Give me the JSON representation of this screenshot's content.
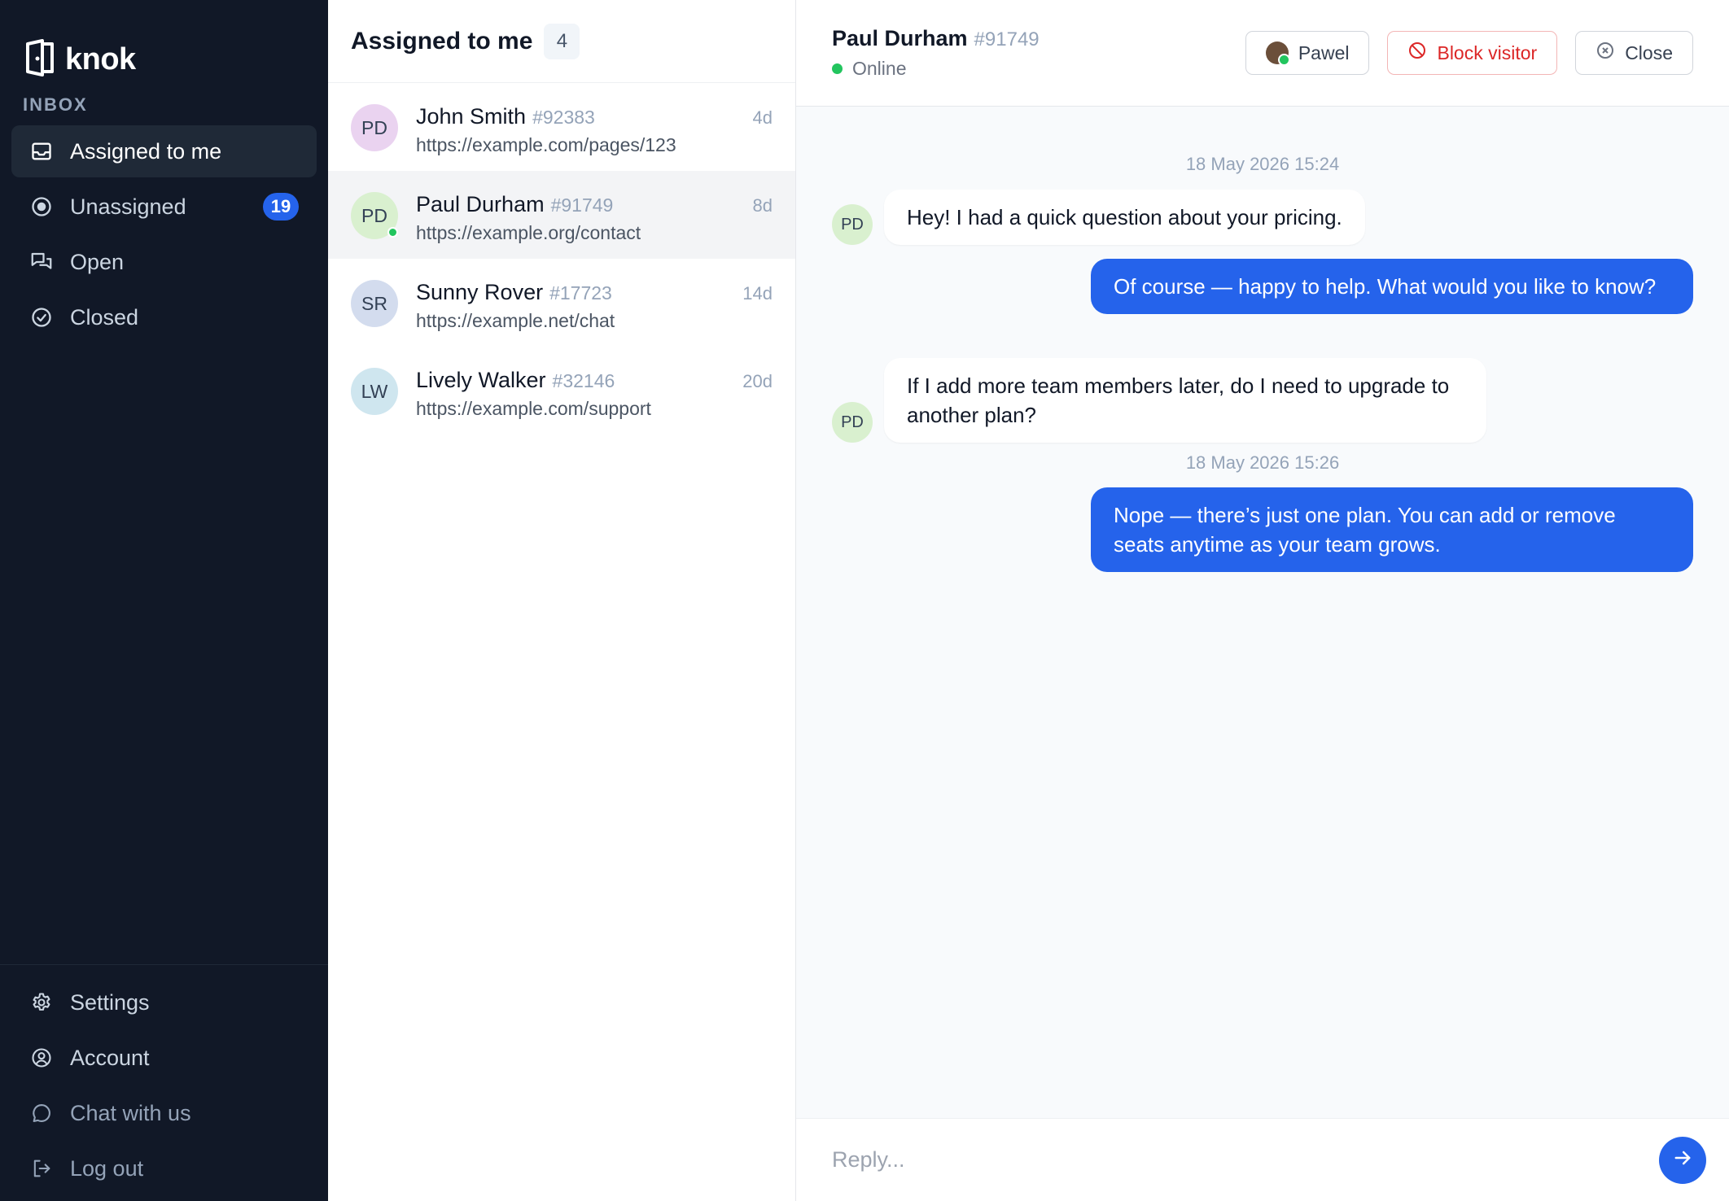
{
  "app": {
    "name": "knok"
  },
  "sidebar": {
    "section_label": "INBOX",
    "items": [
      {
        "label": "Assigned to me",
        "icon": "inbox-icon",
        "active": true
      },
      {
        "label": "Unassigned",
        "icon": "target-icon",
        "badge": "19"
      },
      {
        "label": "Open",
        "icon": "chat-bubbles-icon"
      },
      {
        "label": "Closed",
        "icon": "check-circle-icon"
      }
    ],
    "bottom_items": [
      {
        "label": "Settings",
        "icon": "gear-icon"
      },
      {
        "label": "Account",
        "icon": "user-circle-icon"
      },
      {
        "label": "Chat with us",
        "icon": "chat-bubble-icon"
      },
      {
        "label": "Log out",
        "icon": "logout-icon"
      }
    ]
  },
  "list": {
    "title": "Assigned to me",
    "count": "4",
    "conversations": [
      {
        "initials": "PD",
        "name": "John Smith",
        "id": "#92383",
        "url": "https://example.com/pages/123",
        "time": "4d",
        "avatar_color": "#ead3f0",
        "online": false
      },
      {
        "initials": "PD",
        "name": "Paul Durham",
        "id": "#91749",
        "url": "https://example.org/contact",
        "time": "8d",
        "avatar_color": "#d9f0cf",
        "online": true,
        "selected": true
      },
      {
        "initials": "SR",
        "name": "Sunny Rover",
        "id": "#17723",
        "url": "https://example.net/chat",
        "time": "14d",
        "avatar_color": "#d3dcee",
        "online": false
      },
      {
        "initials": "LW",
        "name": "Lively Walker",
        "id": "#32146",
        "url": "https://example.com/support",
        "time": "20d",
        "avatar_color": "#cfe6ef",
        "online": false
      }
    ]
  },
  "chat": {
    "visitor_name": "Paul Durham",
    "visitor_id": "#91749",
    "status": "Online",
    "actions": {
      "agent": "Pawel",
      "block": "Block visitor",
      "close": "Close"
    },
    "timestamps": [
      "18 May 2026 15:24",
      "18 May 2026 15:26"
    ],
    "messages": [
      {
        "from": "visitor",
        "initials": "PD",
        "text": "Hey! I had a quick question about your pricing."
      },
      {
        "from": "agent",
        "text": "Of course — happy to help. What would you like to know?"
      },
      {
        "from": "visitor",
        "initials": "PD",
        "text": "If I add more team members later, do I need to upgrade to another plan?"
      },
      {
        "from": "agent",
        "text": "Nope — there’s just one plan. You can add or remove seats anytime as your team grows."
      }
    ],
    "reply_placeholder": "Reply..."
  },
  "colors": {
    "sidebar_bg": "#111827",
    "accent": "#2563eb",
    "online": "#22c55e",
    "danger": "#dc2626"
  }
}
